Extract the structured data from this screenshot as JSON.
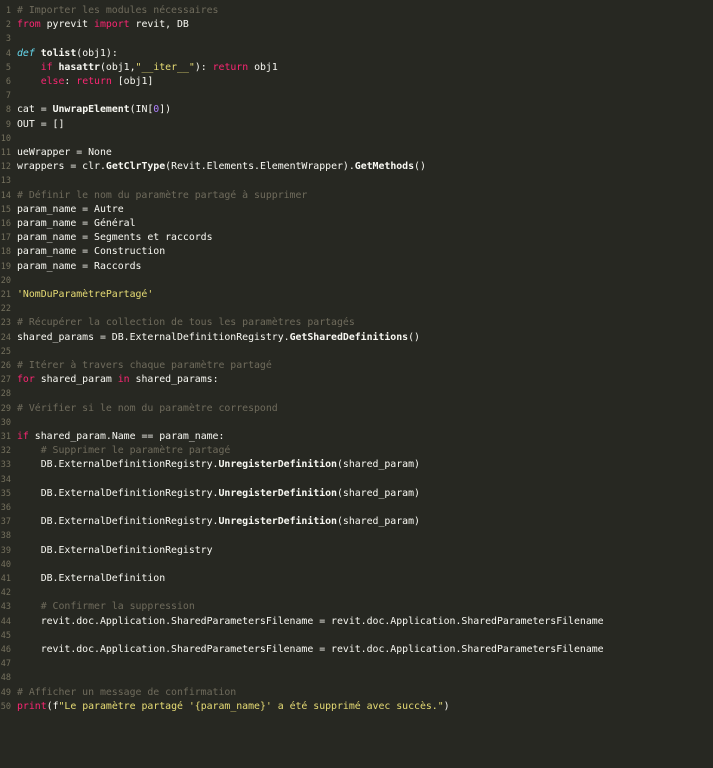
{
  "editor": {
    "language": "python",
    "theme": {
      "background": "#272822",
      "line_number": "#75715e",
      "comment": "#6f6b5c",
      "keyword": "#f92672",
      "def_keyword": "#66d9ef",
      "string": "#e6db74",
      "number": "#ae81ff",
      "text": "#f8f8f2"
    },
    "lines": [
      {
        "n": "1",
        "tokens": [
          [
            "comment",
            "# Importer les modules nécessaires"
          ]
        ]
      },
      {
        "n": "2",
        "tokens": [
          [
            "keyword",
            "from"
          ],
          [
            "plain",
            " pyrevit "
          ],
          [
            "keyword",
            "import"
          ],
          [
            "plain",
            " revit, DB"
          ]
        ]
      },
      {
        "n": "3",
        "tokens": []
      },
      {
        "n": "4",
        "tokens": [
          [
            "def",
            "def"
          ],
          [
            "plain",
            " "
          ],
          [
            "bold",
            "tolist"
          ],
          [
            "plain",
            "(obj1):"
          ]
        ]
      },
      {
        "n": "5",
        "tokens": [
          [
            "plain",
            "    "
          ],
          [
            "keyword",
            "if"
          ],
          [
            "plain",
            " "
          ],
          [
            "bold",
            "hasattr"
          ],
          [
            "plain",
            "(obj1,"
          ],
          [
            "string",
            "\"__iter__\""
          ],
          [
            "plain",
            "): "
          ],
          [
            "keyword",
            "return"
          ],
          [
            "plain",
            " obj1"
          ]
        ]
      },
      {
        "n": "6",
        "tokens": [
          [
            "plain",
            "    "
          ],
          [
            "keyword",
            "else"
          ],
          [
            "plain",
            ": "
          ],
          [
            "keyword",
            "return"
          ],
          [
            "plain",
            " [obj1]"
          ]
        ]
      },
      {
        "n": "7",
        "tokens": []
      },
      {
        "n": "8",
        "tokens": [
          [
            "plain",
            "cat = "
          ],
          [
            "bold",
            "UnwrapElement"
          ],
          [
            "plain",
            "(IN["
          ],
          [
            "number",
            "0"
          ],
          [
            "plain",
            "])"
          ]
        ]
      },
      {
        "n": "9",
        "tokens": [
          [
            "plain",
            "OUT = []"
          ]
        ]
      },
      {
        "n": "10",
        "tokens": []
      },
      {
        "n": "11",
        "tokens": [
          [
            "plain",
            "ueWrapper = None"
          ]
        ]
      },
      {
        "n": "12",
        "tokens": [
          [
            "plain",
            "wrappers = clr."
          ],
          [
            "bold",
            "GetClrType"
          ],
          [
            "plain",
            "(Revit.Elements.ElementWrapper)."
          ],
          [
            "bold",
            "GetMethods"
          ],
          [
            "plain",
            "()"
          ]
        ]
      },
      {
        "n": "13",
        "tokens": []
      },
      {
        "n": "14",
        "tokens": [
          [
            "comment",
            "# Définir le nom du paramètre partagé à supprimer"
          ]
        ]
      },
      {
        "n": "15",
        "tokens": [
          [
            "plain",
            "param_name = Autre"
          ]
        ]
      },
      {
        "n": "16",
        "tokens": [
          [
            "plain",
            "param_name = Général"
          ]
        ]
      },
      {
        "n": "17",
        "tokens": [
          [
            "plain",
            "param_name = Segments et raccords"
          ]
        ]
      },
      {
        "n": "18",
        "tokens": [
          [
            "plain",
            "param_name = Construction"
          ]
        ]
      },
      {
        "n": "19",
        "tokens": [
          [
            "plain",
            "param_name = Raccords"
          ]
        ]
      },
      {
        "n": "20",
        "tokens": []
      },
      {
        "n": "21",
        "tokens": [
          [
            "string",
            "'NomDuParamètrePartagé'"
          ]
        ]
      },
      {
        "n": "22",
        "tokens": []
      },
      {
        "n": "23",
        "tokens": [
          [
            "comment",
            "# Récupérer la collection de tous les paramètres partagés"
          ]
        ]
      },
      {
        "n": "24",
        "tokens": [
          [
            "plain",
            "shared_params = DB.ExternalDefinitionRegistry."
          ],
          [
            "bold",
            "GetSharedDefinitions"
          ],
          [
            "plain",
            "()"
          ]
        ]
      },
      {
        "n": "25",
        "tokens": []
      },
      {
        "n": "26",
        "tokens": [
          [
            "comment",
            "# Itérer à travers chaque paramètre partagé"
          ]
        ]
      },
      {
        "n": "27",
        "tokens": [
          [
            "keyword",
            "for"
          ],
          [
            "plain",
            " shared_param "
          ],
          [
            "keyword",
            "in"
          ],
          [
            "plain",
            " shared_params:"
          ]
        ]
      },
      {
        "n": "28",
        "tokens": []
      },
      {
        "n": "29",
        "tokens": [
          [
            "comment",
            "# Vérifier si le nom du paramètre correspond"
          ]
        ]
      },
      {
        "n": "30",
        "tokens": []
      },
      {
        "n": "31",
        "tokens": [
          [
            "keyword",
            "if"
          ],
          [
            "plain",
            " shared_param.Name == param_name:"
          ]
        ]
      },
      {
        "n": "32",
        "tokens": [
          [
            "plain",
            "    "
          ],
          [
            "comment",
            "# Supprimer le paramètre partagé"
          ]
        ]
      },
      {
        "n": "33",
        "tokens": [
          [
            "plain",
            "    DB.ExternalDefinitionRegistry."
          ],
          [
            "bold",
            "UnregisterDefinition"
          ],
          [
            "plain",
            "(shared_param)"
          ]
        ]
      },
      {
        "n": "34",
        "tokens": []
      },
      {
        "n": "35",
        "tokens": [
          [
            "plain",
            "    DB.ExternalDefinitionRegistry."
          ],
          [
            "bold",
            "UnregisterDefinition"
          ],
          [
            "plain",
            "(shared_param)"
          ]
        ]
      },
      {
        "n": "36",
        "tokens": []
      },
      {
        "n": "37",
        "tokens": [
          [
            "plain",
            "    DB.ExternalDefinitionRegistry."
          ],
          [
            "bold",
            "UnregisterDefinition"
          ],
          [
            "plain",
            "(shared_param)"
          ]
        ]
      },
      {
        "n": "38",
        "tokens": []
      },
      {
        "n": "39",
        "tokens": [
          [
            "plain",
            "    DB.ExternalDefinitionRegistry"
          ]
        ]
      },
      {
        "n": "40",
        "tokens": []
      },
      {
        "n": "41",
        "tokens": [
          [
            "plain",
            "    DB.ExternalDefinition"
          ]
        ]
      },
      {
        "n": "42",
        "tokens": []
      },
      {
        "n": "43",
        "tokens": [
          [
            "plain",
            "    "
          ],
          [
            "comment",
            "# Confirmer la suppression"
          ]
        ]
      },
      {
        "n": "44",
        "tokens": [
          [
            "plain",
            "    revit.doc.Application.SharedParametersFilename = revit.doc.Application.SharedParametersFilename"
          ]
        ]
      },
      {
        "n": "45",
        "tokens": []
      },
      {
        "n": "46",
        "tokens": [
          [
            "plain",
            "    revit.doc.Application.SharedParametersFilename = revit.doc.Application.SharedParametersFilename"
          ]
        ]
      },
      {
        "n": "47",
        "tokens": []
      },
      {
        "n": "48",
        "tokens": []
      },
      {
        "n": "49",
        "tokens": [
          [
            "comment",
            "# Afficher un message de confirmation"
          ]
        ]
      },
      {
        "n": "50",
        "tokens": [
          [
            "keyword",
            "print"
          ],
          [
            "plain",
            "(f"
          ],
          [
            "string",
            "\"Le paramètre partagé '{param_name}' a été supprimé avec succès.\""
          ],
          [
            "plain",
            ")"
          ]
        ]
      }
    ]
  }
}
